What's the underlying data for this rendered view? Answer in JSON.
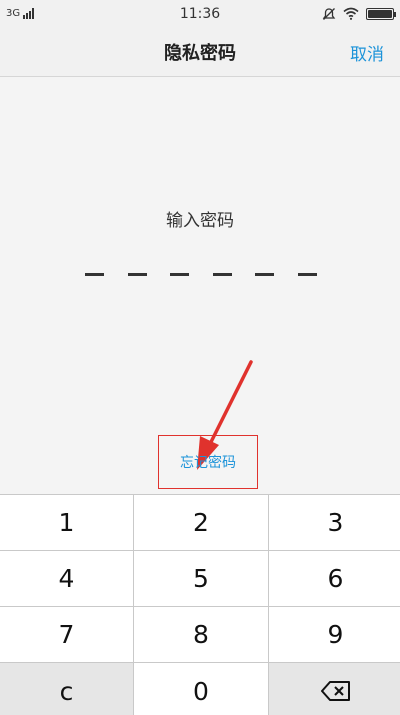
{
  "status_bar": {
    "network": "3G",
    "time": "11:36",
    "icons": [
      "signal-icon",
      "mute-icon",
      "wifi-icon",
      "battery-icon"
    ]
  },
  "nav": {
    "title": "隐私密码",
    "cancel_label": "取消"
  },
  "content": {
    "prompt": "输入密码",
    "pin_slots": 6,
    "forgot_label": "忘记密码"
  },
  "keypad": {
    "keys": [
      "1",
      "2",
      "3",
      "4",
      "5",
      "6",
      "7",
      "8",
      "9",
      "c",
      "0"
    ],
    "delete_icon": "backspace-icon"
  },
  "colors": {
    "accent": "#1c93d9",
    "highlight": "#e0322d",
    "background": "#f4f4f4"
  }
}
